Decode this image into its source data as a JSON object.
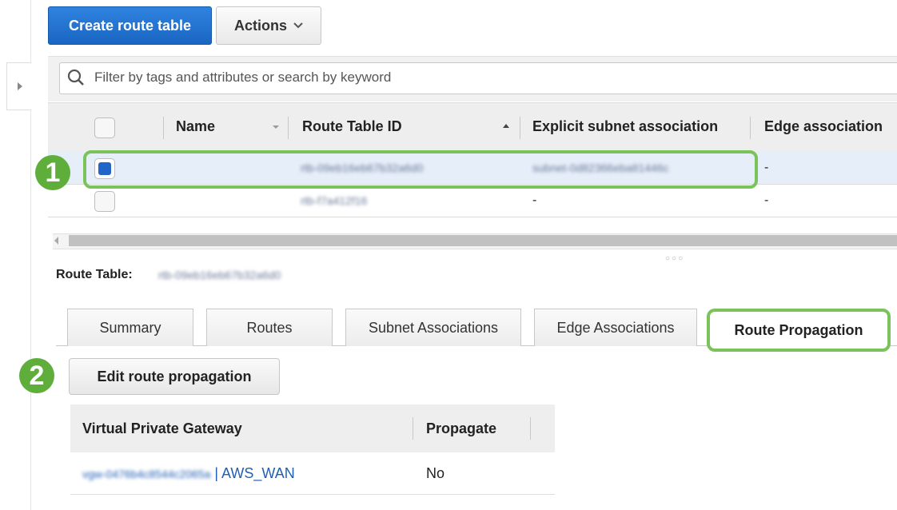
{
  "toolbar": {
    "create_label": "Create route table",
    "actions_label": "Actions"
  },
  "filter": {
    "placeholder": "Filter by tags and attributes or search by keyword"
  },
  "table": {
    "columns": [
      "Name",
      "Route Table ID",
      "Explicit subnet association",
      "Edge association"
    ],
    "rows": [
      {
        "name": "",
        "id": "rtb-09eb16eb67b32a6d0",
        "subnet": "subnet-0d82366eba81446c",
        "edge": "-",
        "selected": true
      },
      {
        "name": "",
        "id": "rtb-f7a412f16",
        "subnet": "-",
        "edge": "-",
        "selected": false
      }
    ]
  },
  "annotations": {
    "step1": "1",
    "step2": "2"
  },
  "details": {
    "label": "Route Table:",
    "value": "rtb-09eb16eb67b32a6d0",
    "tabs": [
      "Summary",
      "Routes",
      "Subnet Associations",
      "Edge Associations",
      "Route Propagation"
    ],
    "edit_button": "Edit route propagation",
    "vpg_table": {
      "columns": [
        "Virtual Private Gateway",
        "Propagate"
      ],
      "rows": [
        {
          "gateway_id": "vgw-0476b4c8544c2065a",
          "gateway_sep": " | ",
          "gateway_name": "AWS_WAN",
          "propagate": "No"
        }
      ]
    }
  },
  "colors": {
    "primary": "#1f6fcf",
    "highlight": "#7ac35a",
    "badge": "#5fae3c",
    "link": "#1f5fb5"
  }
}
